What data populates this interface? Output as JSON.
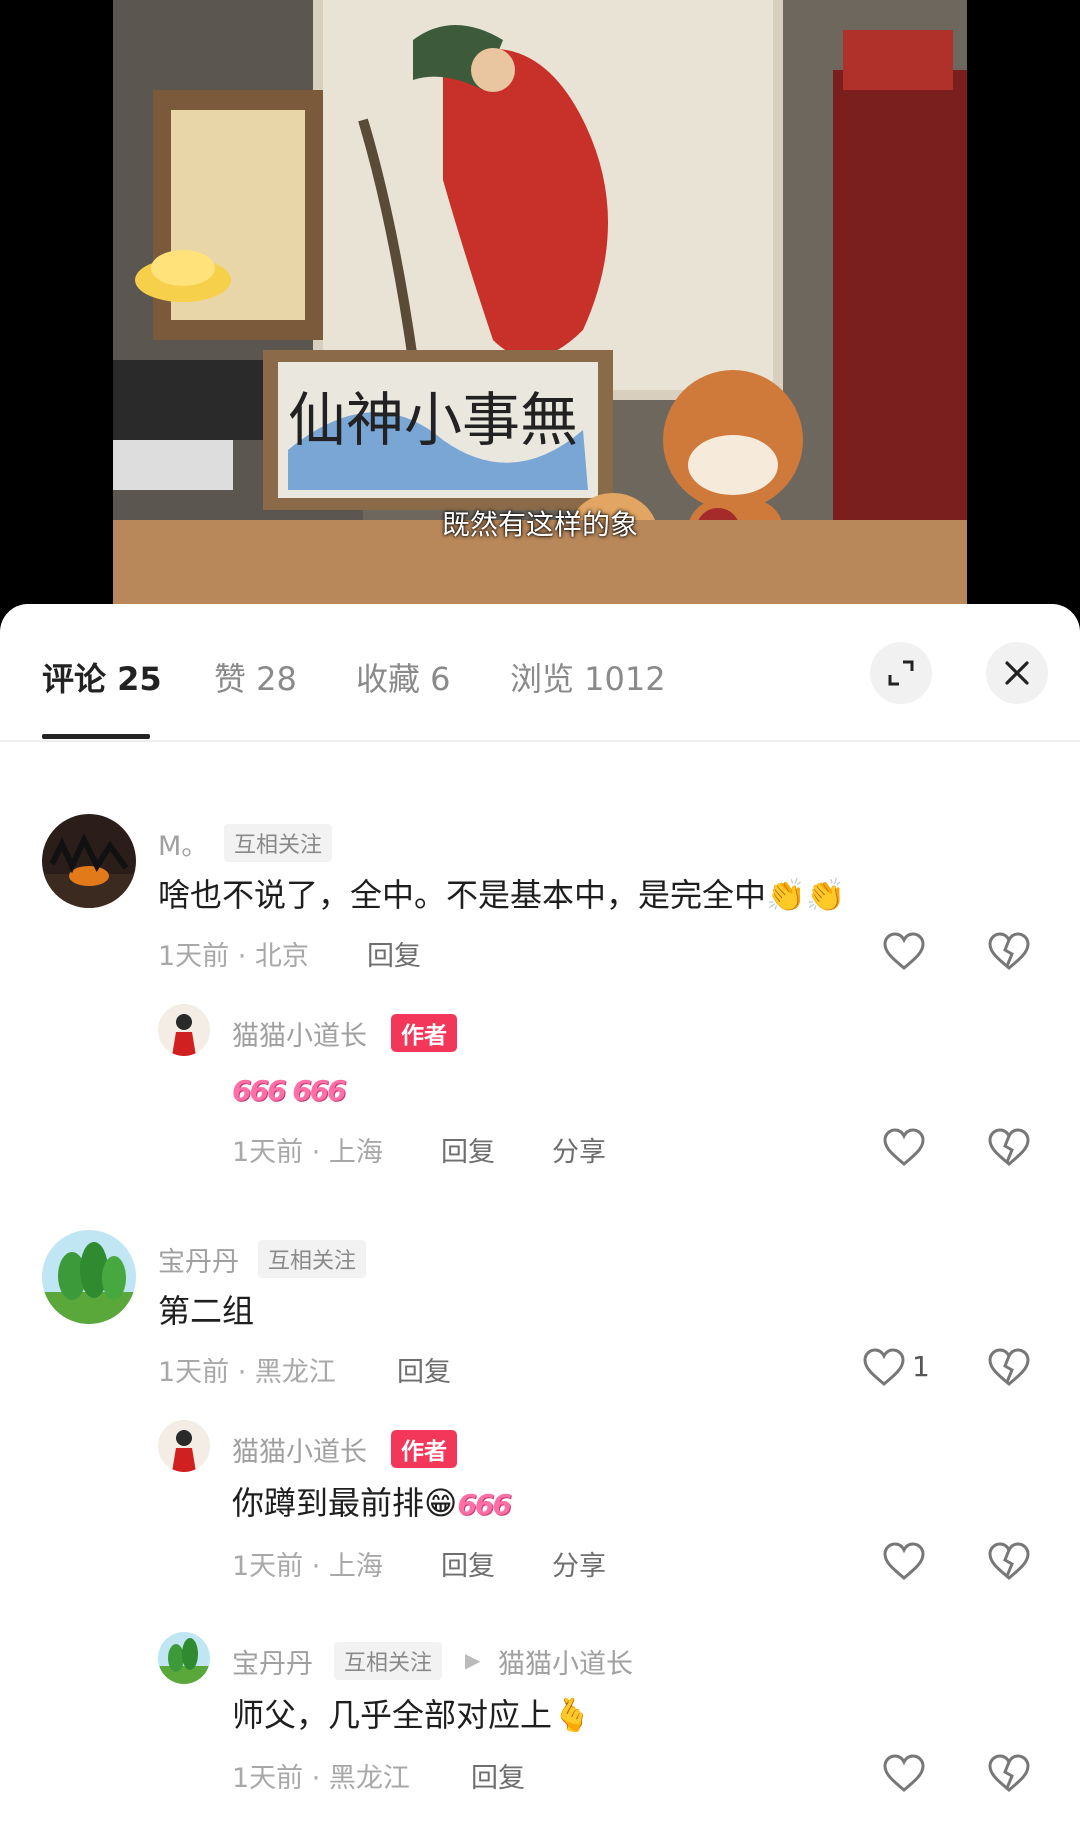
{
  "video": {
    "subtitle": "既然有这样的象"
  },
  "tabs": [
    {
      "label": "评论 25"
    },
    {
      "label": "赞 28"
    },
    {
      "label": "收藏 6"
    },
    {
      "label": "浏览 1012"
    }
  ],
  "comments": [
    {
      "user": "M。",
      "tag": "互相关注",
      "text": "啥也不说了，全中。不是基本中，是完全中",
      "emoji": "👏👏",
      "meta": "1天前 · 北京",
      "reply": "回复"
    },
    {
      "user": "猫猫小道长",
      "author_tag": "作者",
      "text": "666 666",
      "meta": "1天前 · 上海",
      "reply": "回复",
      "share": "分享"
    },
    {
      "user": "宝丹丹",
      "tag": "互相关注",
      "text": "第二组",
      "meta": "1天前 · 黑龙江",
      "reply": "回复",
      "likes": "1"
    },
    {
      "user": "猫猫小道长",
      "author_tag": "作者",
      "text": "你蹲到最前排",
      "emoji": "😁",
      "six": "666",
      "meta": "1天前 · 上海",
      "reply": "回复",
      "share": "分享"
    },
    {
      "user": "宝丹丹",
      "tag": "互相关注",
      "reply_to": "猫猫小道长",
      "text": "师父，几乎全部对应上",
      "emoji": "🫰",
      "meta": "1天前 · 黑龙江",
      "reply": "回复"
    }
  ],
  "colors": {
    "author_tag_bg": "#f2375a",
    "active_tab": "#222222",
    "inactive_tab": "#8a8a8a"
  },
  "icons": [
    "expand-icon",
    "close-icon",
    "heart-icon",
    "broken-heart-icon"
  ]
}
